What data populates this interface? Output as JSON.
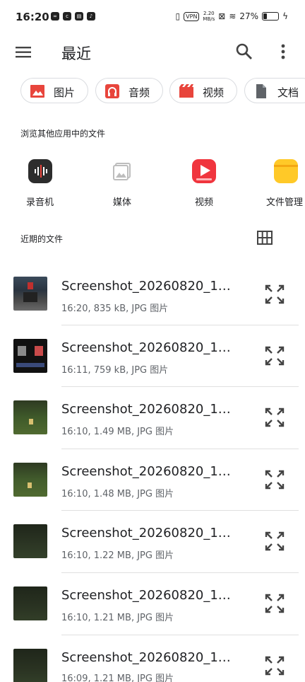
{
  "status_bar": {
    "time": "16:20",
    "vpn": "VPN",
    "speed_value": "2.20",
    "speed_unit": "MB/s",
    "battery": "27%",
    "battery_level": 0.27
  },
  "app_bar": {
    "title": "最近"
  },
  "chips": [
    {
      "label": "图片",
      "icon": "image-icon",
      "color": "#e8453c"
    },
    {
      "label": "音频",
      "icon": "headphones-icon",
      "color": "#e8453c"
    },
    {
      "label": "视频",
      "icon": "film-icon",
      "color": "#e8453c"
    },
    {
      "label": "文档",
      "icon": "document-icon",
      "color": "#5f6368"
    }
  ],
  "browse_section": {
    "title": "浏览其他应用中的文件",
    "apps": [
      {
        "label": "录音机",
        "icon": "recorder-icon"
      },
      {
        "label": "媒体",
        "icon": "media-icon"
      },
      {
        "label": "视频",
        "icon": "video-app-icon"
      },
      {
        "label": "文件管理",
        "icon": "folder-icon"
      }
    ]
  },
  "recent_section": {
    "title": "近期的文件"
  },
  "files": [
    {
      "name": "Screenshot_20260820_1…",
      "meta": "16:20, 835 kB, JPG 图片"
    },
    {
      "name": "Screenshot_20260820_1…",
      "meta": "16:11, 759 kB, JPG 图片"
    },
    {
      "name": "Screenshot_20260820_1…",
      "meta": "16:10, 1.49 MB, JPG 图片"
    },
    {
      "name": "Screenshot_20260820_1…",
      "meta": "16:10, 1.48 MB, JPG 图片"
    },
    {
      "name": "Screenshot_20260820_1…",
      "meta": "16:10, 1.22 MB, JPG 图片"
    },
    {
      "name": "Screenshot_20260820_1…",
      "meta": "16:10, 1.21 MB, JPG 图片"
    },
    {
      "name": "Screenshot_20260820_1…",
      "meta": "16:09, 1.21 MB, JPG 图片"
    }
  ]
}
